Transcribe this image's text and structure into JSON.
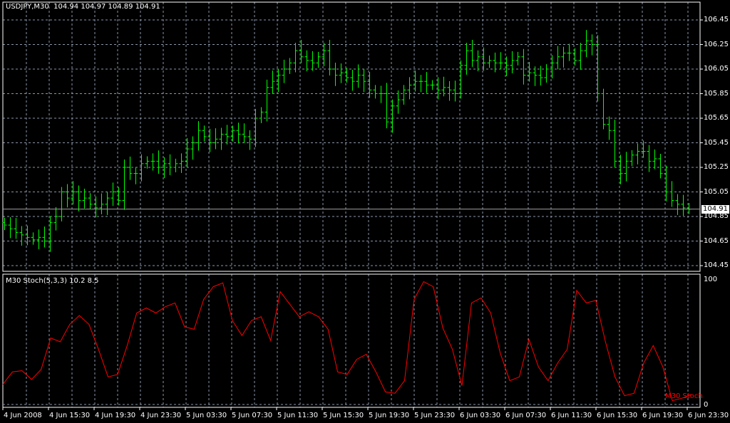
{
  "chart_header": {
    "symbol": "USDJPY,M30",
    "open": "104.94",
    "high": "104.97",
    "low": "104.89",
    "close": "104.91"
  },
  "price_axis": [
    "106.45",
    "106.25",
    "106.05",
    "105.85",
    "105.65",
    "105.45",
    "105.25",
    "105.05",
    "104.85",
    "104.65",
    "104.45"
  ],
  "current_price": "104.91",
  "indicator": {
    "header": "M30 Stoch(5,3,3) 10.2 8.5",
    "label": "M30 Stoch",
    "axis": [
      "100",
      "0"
    ],
    "color": "#ff0000"
  },
  "time_axis": [
    "4 Jun 2008",
    "4 Jun 15:30",
    "4 Jun 19:30",
    "4 Jun 23:30",
    "5 Jun 03:30",
    "5 Jun 07:30",
    "5 Jun 11:30",
    "5 Jun 15:30",
    "5 Jun 19:30",
    "5 Jun 23:30",
    "6 Jun 03:30",
    "6 Jun 07:30",
    "6 Jun 11:30",
    "6 Jun 15:30",
    "6 Jun 19:30",
    "6 Jun 23:30"
  ],
  "colors": {
    "background": "#000000",
    "bars": "#00ff00",
    "grid": "#8a96a8",
    "axis": "#ffffff",
    "stoch": "#ff0000"
  },
  "chart_data": {
    "type": "ohlc",
    "timeframe": "M30",
    "ylim": [
      104.45,
      106.45
    ],
    "closes": [
      104.78,
      104.75,
      104.72,
      104.7,
      104.68,
      104.66,
      104.68,
      104.65,
      104.8,
      104.85,
      105.05,
      105.0,
      105.05,
      104.98,
      105.0,
      104.95,
      104.92,
      104.95,
      105.0,
      105.05,
      104.98,
      105.25,
      105.2,
      105.2,
      105.28,
      105.3,
      105.3,
      105.25,
      105.28,
      105.25,
      105.28,
      105.3,
      105.4,
      105.45,
      105.55,
      105.5,
      105.45,
      105.48,
      105.52,
      105.5,
      105.55,
      105.52,
      105.5,
      105.48,
      105.65,
      105.7,
      105.9,
      105.95,
      106.0,
      106.05,
      106.1,
      106.2,
      106.15,
      106.12,
      106.1,
      106.15,
      106.2,
      106.05,
      106.0,
      106.02,
      105.98,
      105.95,
      106.0,
      105.95,
      105.88,
      105.85,
      105.85,
      105.62,
      105.75,
      105.8,
      105.88,
      105.92,
      105.95,
      105.95,
      105.92,
      105.92,
      105.88,
      105.9,
      105.88,
      105.85,
      106.08,
      106.2,
      106.12,
      106.15,
      106.1,
      106.12,
      106.1,
      106.1,
      106.08,
      106.12,
      106.15,
      106.0,
      106.02,
      106.0,
      105.98,
      106.05,
      106.1,
      106.15,
      106.18,
      106.18,
      106.12,
      106.2,
      106.28,
      106.25,
      105.85,
      105.6,
      105.55,
      105.3,
      105.2,
      105.3,
      105.35,
      105.38,
      105.38,
      105.3,
      105.32,
      105.2,
      105.05,
      104.98,
      104.95,
      104.92,
      104.91
    ],
    "stoch": {
      "ylim": [
        0,
        100
      ],
      "values": [
        16,
        26,
        27,
        20,
        28,
        53,
        50,
        64,
        71,
        64,
        44,
        22,
        24,
        47,
        73,
        77,
        73,
        78,
        81,
        62,
        60,
        84,
        94,
        97,
        67,
        55,
        67,
        70,
        51,
        90,
        80,
        70,
        74,
        70,
        60,
        26,
        24,
        36,
        40,
        26,
        10,
        9,
        19,
        84,
        98,
        94,
        61,
        44,
        15,
        81,
        85,
        73,
        41,
        19,
        22,
        52,
        30,
        19,
        33,
        44,
        91,
        81,
        83,
        50,
        22,
        7,
        9,
        33,
        47,
        30,
        3,
        5,
        8
      ]
    }
  }
}
